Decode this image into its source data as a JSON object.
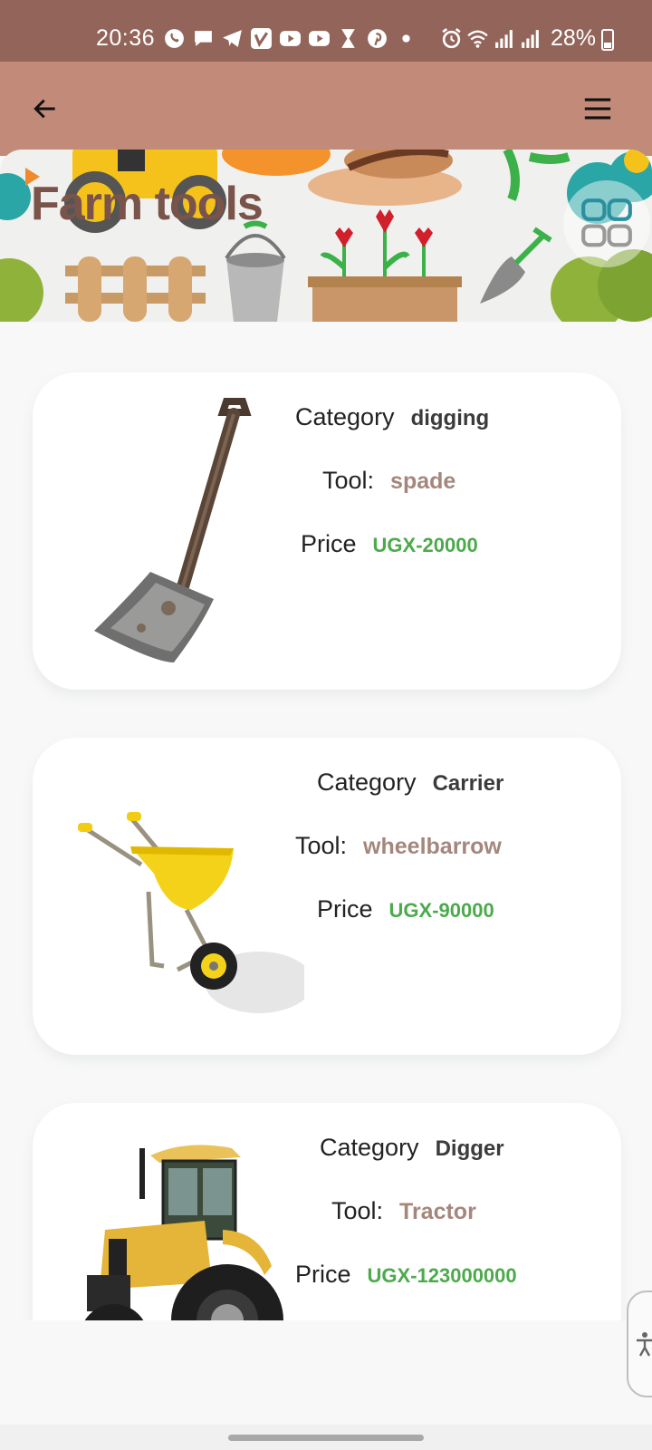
{
  "status_bar": {
    "time": "20:36",
    "battery_percent": "28%",
    "left_icons": [
      "whatsapp-icon",
      "messages-icon",
      "telegram-icon",
      "vimeo-icon",
      "youtube-icon",
      "youtube-icon",
      "hourglass-icon",
      "pinterest-icon",
      "dot-icon"
    ],
    "right_icons": [
      "alarm-icon",
      "wifi-icon",
      "signal-icon",
      "signal-icon"
    ]
  },
  "app_bar": {
    "back_icon": "arrow-left-icon",
    "menu_icon": "hamburger-menu-icon"
  },
  "header": {
    "title": "Farm tools"
  },
  "tools": [
    {
      "category_label": "Category",
      "category": "digging",
      "tool_label": "Tool:",
      "tool": "spade",
      "price_label": "Price",
      "price": "UGX-20000",
      "image": "spade-image"
    },
    {
      "category_label": "Category",
      "category": "Carrier",
      "tool_label": "Tool:",
      "tool": "wheelbarrow",
      "price_label": "Price",
      "price": "UGX-90000",
      "image": "wheelbarrow-image"
    },
    {
      "category_label": "Category",
      "category": "Digger",
      "tool_label": "Tool:",
      "tool": "Tractor",
      "price_label": "Price",
      "price": "UGX-123000000",
      "image": "tractor-image"
    }
  ],
  "colors": {
    "status_bar": "#93655a",
    "app_bar": "#c28a79",
    "title": "#7a544a",
    "tool_name": "#a4877c",
    "price": "#4caa4c"
  }
}
